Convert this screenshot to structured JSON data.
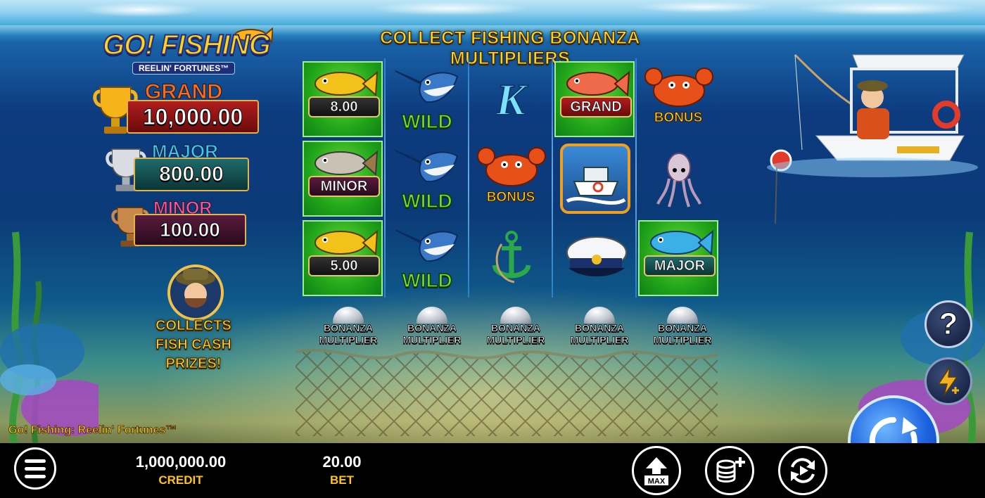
{
  "colors": {
    "gold": "#ffd21f",
    "grand": "#ff6a1a",
    "major": "#35c8ff",
    "minor": "#ff4fa0",
    "wild_green": "#7cde2a",
    "reel_green": "#22a61a",
    "label_yellow": "#ffc21a"
  },
  "header": {
    "headline": "COLLECT FISHING BONANZA MULTIPLIERS"
  },
  "logo": {
    "main": "GO! FISHING",
    "sub": "REELIN' FORTUNES™"
  },
  "jackpots": [
    {
      "name": "GRAND",
      "value": "10,000.00",
      "trophy": "gold-trophy-icon"
    },
    {
      "name": "MAJOR",
      "value": "800.00",
      "trophy": "silver-trophy-icon"
    },
    {
      "name": "MINOR",
      "value": "100.00",
      "trophy": "bronze-trophy-icon"
    }
  ],
  "collector": {
    "line1": "COLLECTS",
    "line2": "FISH CASH",
    "line3": "PRIZES!"
  },
  "reels": [
    [
      {
        "symbol": "yellow-fish",
        "label": "8.00"
      },
      {
        "symbol": "grey-fish",
        "label": "MINOR"
      },
      {
        "symbol": "yellow-fish",
        "label": "5.00"
      }
    ],
    [
      {
        "symbol": "marlin-wild",
        "label": "WILD"
      },
      {
        "symbol": "marlin-wild",
        "label": "WILD"
      },
      {
        "symbol": "marlin-wild",
        "label": "WILD"
      }
    ],
    [
      {
        "symbol": "letter-k",
        "label": "K"
      },
      {
        "symbol": "crab-bonus",
        "label": "BONUS"
      },
      {
        "symbol": "anchor",
        "label": ""
      }
    ],
    [
      {
        "symbol": "red-fish",
        "label": "GRAND"
      },
      {
        "symbol": "boat",
        "label": ""
      },
      {
        "symbol": "captain-hat",
        "label": ""
      }
    ],
    [
      {
        "symbol": "crab-bonus",
        "label": "BONUS"
      },
      {
        "symbol": "squid",
        "label": ""
      },
      {
        "symbol": "blue-fish",
        "label": "MAJOR"
      }
    ]
  ],
  "bells": [
    "BONANZA MULTIPLIER",
    "BONANZA MULTIPLIER",
    "BONANZA MULTIPLIER",
    "BONANZA MULTIPLIER",
    "BONANZA MULTIPLIER"
  ],
  "game_title": "Go! Fishing: Reelin' Fortunes™",
  "controls": {
    "help": "?",
    "credit_value": "1,000,000.00",
    "credit_label": "CREDIT",
    "bet_value": "20.00",
    "bet_label": "BET",
    "max_label": "MAX"
  }
}
